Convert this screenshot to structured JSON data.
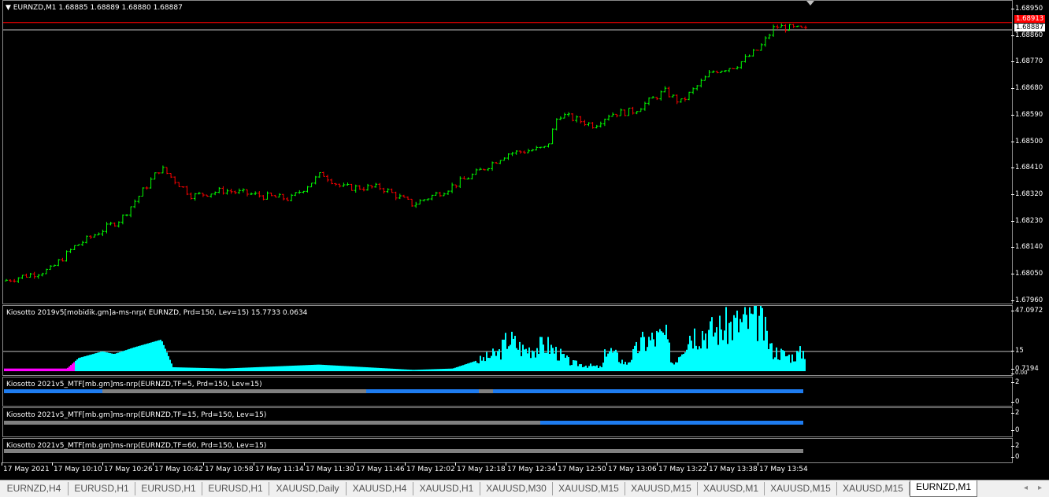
{
  "main": {
    "header": "EURNZD,M1  1.68885 1.68889 1.68880 1.68887",
    "price_ticks": [
      "1.68950",
      "1.68860",
      "1.68770",
      "1.68680",
      "1.68590",
      "1.68500",
      "1.68410",
      "1.68320",
      "1.68230",
      "1.68140",
      "1.68050",
      "1.67960"
    ],
    "ask_tag": "1.68913",
    "bid_tag": "1.68887",
    "price_range": [
      1.6792,
      1.6899
    ],
    "candles_count": 200,
    "colors": {
      "up": "#00ff00",
      "down": "#ff0000",
      "ask_line": "#ff0000",
      "bid_line": "#c0c0c0"
    }
  },
  "ind1": {
    "label": "Kiosotto 2019v5[mobidik.gm]a-ms-nrp( EURNZD, Prd=150, Lev=15) 15.7733 0.0634",
    "ticks": [
      "47.0972",
      "15",
      "0.7194",
      "0.00"
    ],
    "colors": {
      "bulls": "#00ffff",
      "bears": "#ff00ff",
      "level": "#c0c0c0"
    }
  },
  "ind2": {
    "label": "Kiosotto 2021v5_MTF[mb.gm]ms-nrp(EURNZD,TF=5, Prd=150, Lev=15)",
    "ticks": [
      "2",
      "0"
    ]
  },
  "ind3": {
    "label": "Kiosotto 2021v5_MTF[mb.gm]ms-nrp(EURNZD,TF=15, Prd=150, Lev=15)",
    "ticks": [
      "2",
      "0"
    ]
  },
  "ind4": {
    "label": "Kiosotto 2021v5_MTF[mb.gm]ms-nrp(EURNZD,TF=60, Prd=150, Lev=15)",
    "ticks": [
      "2",
      "0"
    ]
  },
  "time_labels": [
    "17 May 2021",
    "17 May 10:10",
    "17 May 10:26",
    "17 May 10:42",
    "17 May 10:58",
    "17 May 11:14",
    "17 May 11:30",
    "17 May 11:46",
    "17 May 12:02",
    "17 May 12:18",
    "17 May 12:34",
    "17 May 12:50",
    "17 May 13:06",
    "17 May 13:22",
    "17 May 13:38",
    "17 May 13:54"
  ],
  "tabs": [
    "EURNZD,H4",
    "EURUSD,H1",
    "EURUSD,H1",
    "EURUSD,H1",
    "XAUUSD,Daily",
    "XAUUSD,H4",
    "XAUUSD,H1",
    "XAUUSD,M30",
    "XAUUSD,M15",
    "XAUUSD,M15",
    "XAUUSD,M1",
    "XAUUSD,M15",
    "XAUUSD,M15",
    "EURNZD,M1"
  ],
  "active_tab": "EURNZD,M1",
  "scroll": {
    "left": "◂",
    "right": "▸"
  }
}
